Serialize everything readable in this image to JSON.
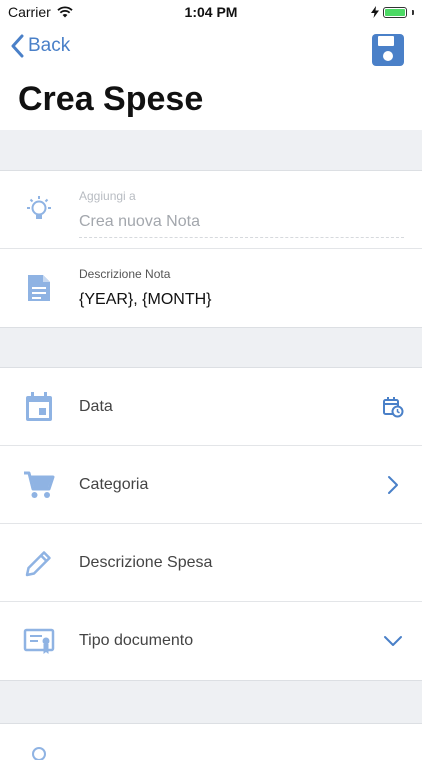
{
  "status_bar": {
    "carrier": "Carrier",
    "time": "1:04 PM"
  },
  "nav": {
    "back_label": "Back",
    "title": "Crea Spese"
  },
  "note_section": {
    "add_to": {
      "caption": "Aggiungi a",
      "placeholder": "Crea nuova Nota"
    },
    "description": {
      "caption": "Descrizione Nota",
      "value": "{YEAR}, {MONTH}"
    }
  },
  "expense_section": {
    "items": [
      {
        "label": "Data"
      },
      {
        "label": "Categoria"
      },
      {
        "label": "Descrizione Spesa"
      },
      {
        "label": "Tipo documento"
      }
    ]
  },
  "colors": {
    "accent": "#4a80c8",
    "icon": "#8fb3e3",
    "background": "#eef0f3"
  }
}
